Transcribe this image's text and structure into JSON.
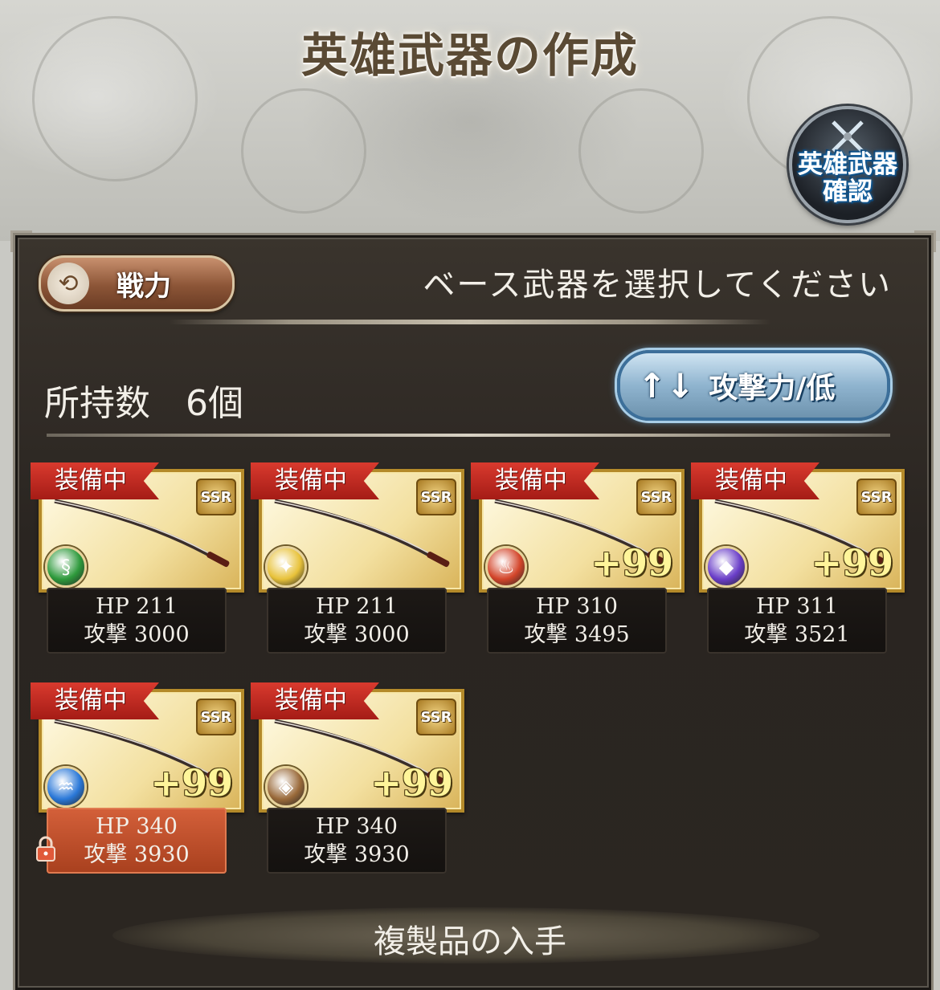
{
  "header": {
    "title": "英雄武器の作成",
    "confirm_button": "英雄武器\n確認"
  },
  "toolbar": {
    "power_label": "戦力",
    "instruction": "ベース武器を選択してください",
    "count_label": "所持数　6個",
    "sort_label": "攻撃力/低",
    "sort_icon": "↑↓"
  },
  "weapons": [
    {
      "tag": "装備中",
      "rarity": "SSR",
      "element": "wind",
      "plus": "",
      "hp": "HP  211",
      "atk": "攻撃 3000",
      "locked": false
    },
    {
      "tag": "装備中",
      "rarity": "SSR",
      "element": "light",
      "plus": "",
      "hp": "HP  211",
      "atk": "攻撃 3000",
      "locked": false
    },
    {
      "tag": "装備中",
      "rarity": "SSR",
      "element": "fire",
      "plus": "+99",
      "hp": "HP  310",
      "atk": "攻撃 3495",
      "locked": false
    },
    {
      "tag": "装備中",
      "rarity": "SSR",
      "element": "dark",
      "plus": "+99",
      "hp": "HP  311",
      "atk": "攻撃 3521",
      "locked": false
    },
    {
      "tag": "装備中",
      "rarity": "SSR",
      "element": "water",
      "plus": "+99",
      "hp": "HP  340",
      "atk": "攻撃 3930",
      "locked": true
    },
    {
      "tag": "装備中",
      "rarity": "SSR",
      "element": "earth",
      "plus": "+99",
      "hp": "HP  340",
      "atk": "攻撃 3930",
      "locked": false
    }
  ],
  "footer": {
    "acquire_label": "複製品の入手"
  },
  "colors": {
    "wind": "#2e9a3c",
    "light": "#e8c23a",
    "fire": "#d3452a",
    "dark": "#6a3ec8",
    "water": "#2a78d8",
    "earth": "#9a6a3a",
    "equipped_tag": "#c22a22"
  }
}
